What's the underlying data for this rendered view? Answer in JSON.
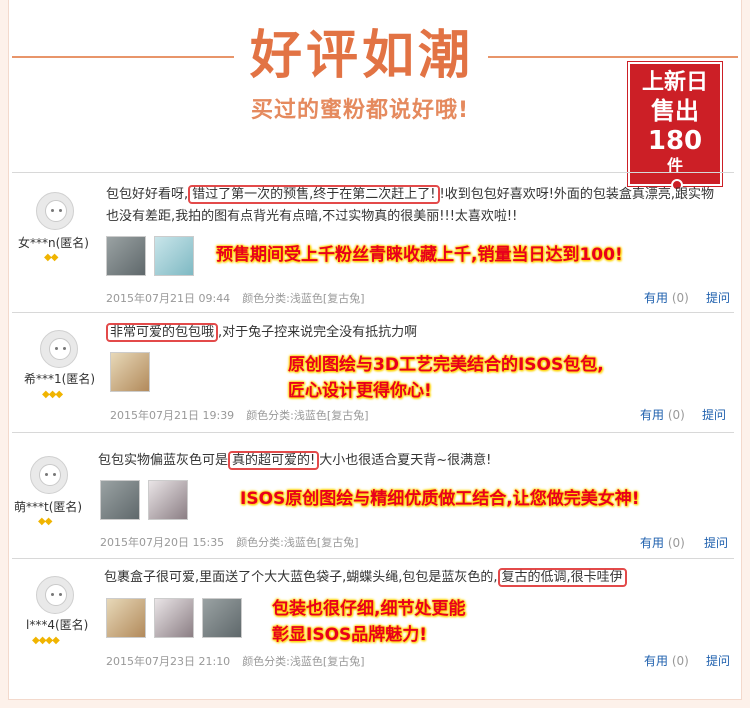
{
  "header": {
    "title": "好评如潮",
    "subtitle": "买过的蜜粉都说好哦!",
    "badge": {
      "line1": "上新日",
      "line2": "售出",
      "line3": "180",
      "line4": "件"
    }
  },
  "labels": {
    "useful": "有用",
    "ask": "提问",
    "color_prefix": "颜色分类:"
  },
  "reviews": [
    {
      "username": "女***n(匿名)",
      "level_icons": "◆◆",
      "text_before": "包包好好看呀,",
      "text_highlight": "错过了第一次的预售,终于在第二次赶上了!",
      "text_after": "!收到包包好喜欢呀!外面的包装盒真漂亮,跟实物也没有差距,我拍的图有点背光有点暗,不过实物真的很美丽!!!太喜欢啦!!",
      "promo": "预售期间受上千粉丝青睐收藏上千,销量当日达到100!",
      "date": "2015年07月21日 09:44",
      "color": "浅蓝色[复古兔]",
      "useful_count": "(0)"
    },
    {
      "username": "希***1(匿名)",
      "level_icons": "◆◆◆",
      "text_before": "",
      "text_highlight": "非常可爱的包包哦",
      "text_after": ",对于兔子控来说完全没有抵抗力啊",
      "promo_line1": "原创图绘与3D工艺完美结合的ISOS包包,",
      "promo_line2": "匠心设计更得你心!",
      "date": "2015年07月21日 19:39",
      "color": "浅蓝色[复古兔]",
      "useful_count": "(0)"
    },
    {
      "username": "萌***t(匿名)",
      "level_icons": "◆◆",
      "text_before": "包包实物偏蓝灰色可是",
      "text_highlight": "真的超可爱的!",
      "text_after": "大小也很适合夏天背~很满意!",
      "promo": "ISOS原创图绘与精细优质做工结合,让您做完美女神!",
      "date": "2015年07月20日 15:35",
      "color": "浅蓝色[复古兔]",
      "useful_count": "(0)"
    },
    {
      "username": "l***4(匿名)",
      "level_icons": "◆◆◆◆",
      "text_before": "包裹盒子很可爱,里面送了个大大蓝色袋子,蝴蝶头绳,包包是蓝灰色的,",
      "text_highlight": "复古的低调,很卡哇伊",
      "text_after": "",
      "promo_line1": "包装也很仔细,细节处更能",
      "promo_line2": "彰显ISOS品牌魅力!",
      "date": "2015年07月23日 21:10",
      "color": "浅蓝色[复古兔]",
      "useful_count": "(0)"
    }
  ]
}
